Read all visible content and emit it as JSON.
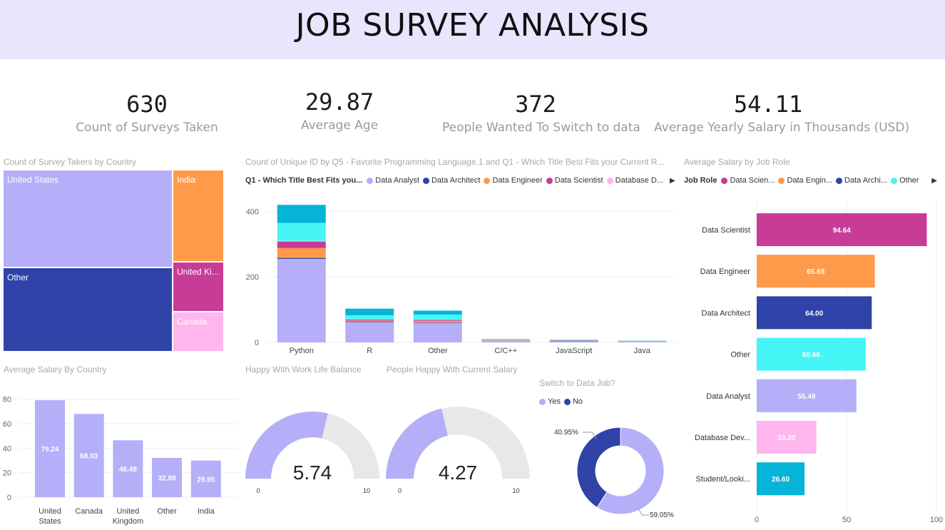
{
  "header": {
    "title": "JOB SURVEY ANALYSIS"
  },
  "kpis": [
    {
      "value": "630",
      "label": "Count of Surveys Taken"
    },
    {
      "value": "29.87",
      "label": "Average Age"
    },
    {
      "value": "372",
      "label": "People Wanted To Switch to data"
    },
    {
      "value": "54.11",
      "label": "Average Yearly Salary in Thousands (USD)"
    }
  ],
  "colors": {
    "Data Analyst": "#b4aff8",
    "Data Architect": "#2f43a8",
    "Data Engineer": "#ff9a4a",
    "Data Scientist": "#c83c98",
    "Database Developer": "#ffb6ee",
    "Other": "#46f5f5",
    "Student/Looking": "#05b4d6",
    "gauge_bg": "#e8e8e8"
  },
  "treemap": {
    "title": "Count of Survey Takers by Country",
    "cells": [
      {
        "label": "United States",
        "color": "#b4aff8"
      },
      {
        "label": "India",
        "color": "#ff9a4a"
      },
      {
        "label": "Other",
        "color": "#2f43a8"
      },
      {
        "label": "United Ki...",
        "color": "#c83c98"
      },
      {
        "label": "Canada",
        "color": "#ffb6ee"
      }
    ]
  },
  "lang_chart": {
    "title": "Count of Unique ID by Q5 - Favorite Programming Language.1 and Q1 - Which Title Best Fits your Current R...",
    "legend_title": "Q1 - Which Title Best Fits you...",
    "legend_items": [
      {
        "label": "Data Analyst",
        "color": "#b4aff8"
      },
      {
        "label": "Data Architect",
        "color": "#2f43a8"
      },
      {
        "label": "Data Engineer",
        "color": "#ff9a4a"
      },
      {
        "label": "Data Scientist",
        "color": "#c83c98"
      },
      {
        "label": "Database D...",
        "color": "#ffb6ee"
      }
    ],
    "legend_more": "▶"
  },
  "salary_country": {
    "title": "Average Salary By Country"
  },
  "gauge_wlb": {
    "title": "Happy With Work Life Balance",
    "value": "5.74",
    "min": "0",
    "max": "10"
  },
  "gauge_salary": {
    "title": "People Happy With Current Salary",
    "value": "4.27",
    "min": "0",
    "max": "10"
  },
  "donut": {
    "title": "Switch to Data Job?",
    "legend_items": [
      {
        "label": "Yes",
        "color": "#b4aff8"
      },
      {
        "label": "No",
        "color": "#2f43a8"
      }
    ],
    "no_label": "40.95%",
    "yes_label": "59.05%"
  },
  "salary_role": {
    "title": "Average Salary by Job Role",
    "legend_title": "Job Role",
    "legend_items": [
      {
        "label": "Data Scien...",
        "color": "#c83c98"
      },
      {
        "label": "Data Engin...",
        "color": "#ff9a4a"
      },
      {
        "label": "Data Archi...",
        "color": "#2f43a8"
      },
      {
        "label": "Other",
        "color": "#46f5f5"
      }
    ],
    "legend_more": "▶"
  },
  "chart_data": [
    {
      "type": "treemap",
      "title": "Count of Survey Takers by Country",
      "categories": [
        "United States",
        "Other",
        "India",
        "United Kingdom",
        "Canada"
      ],
      "values": [
        262,
        197,
        74,
        40,
        33
      ]
    },
    {
      "type": "bar",
      "stacked": true,
      "title": "Count of Unique ID by Q5 - Favorite Programming Language.1 and Q1 - Which Title Best Fits your Current R...",
      "categories": [
        "Python",
        "R",
        "Other",
        "C/C++",
        "JavaScript",
        "Java"
      ],
      "ylim": [
        0,
        440
      ],
      "yticks": [
        0,
        200,
        400
      ],
      "series": [
        {
          "name": "Data Analyst",
          "values": [
            255,
            62,
            60,
            5,
            3,
            2
          ]
        },
        {
          "name": "Data Architect",
          "values": [
            3,
            2,
            1,
            0,
            1,
            0
          ]
        },
        {
          "name": "Data Engineer",
          "values": [
            30,
            3,
            5,
            1,
            1,
            1
          ]
        },
        {
          "name": "Data Scientist",
          "values": [
            20,
            3,
            3,
            1,
            1,
            0
          ]
        },
        {
          "name": "Database D...",
          "values": [
            2,
            1,
            1,
            0,
            0,
            0
          ]
        },
        {
          "name": "Other",
          "values": [
            55,
            12,
            15,
            2,
            1,
            1
          ]
        },
        {
          "values": [
            55,
            20,
            12,
            1,
            1,
            1
          ]
        }
      ]
    },
    {
      "type": "bar",
      "title": "Average Salary By Country",
      "categories": [
        "United States",
        "Canada",
        "United Kingdom",
        "Other",
        "India"
      ],
      "category_lines": [
        [
          "United",
          "States"
        ],
        [
          "Canada"
        ],
        [
          "United",
          "Kingdom"
        ],
        [
          "Other"
        ],
        [
          "India"
        ]
      ],
      "values": [
        79.24,
        68.03,
        46.48,
        32.09,
        29.95
      ],
      "value_labels": [
        "79.24",
        "68.03",
        "46.48",
        "32.09",
        "29.95"
      ],
      "ylim": [
        0,
        88
      ],
      "yticks": [
        0,
        20,
        40,
        60,
        80
      ]
    },
    {
      "type": "gauge",
      "title": "Happy With Work Life Balance",
      "value": 5.74,
      "min": 0,
      "max": 10
    },
    {
      "type": "gauge",
      "title": "People Happy With Current Salary",
      "value": 4.27,
      "min": 0,
      "max": 10
    },
    {
      "type": "pie",
      "title": "Switch to Data Job?",
      "categories": [
        "Yes",
        "No"
      ],
      "values": [
        59.05,
        40.95
      ]
    },
    {
      "type": "bar",
      "orientation": "horizontal",
      "title": "Average Salary by Job Role",
      "categories": [
        "Data Scientist",
        "Data Engineer",
        "Data Architect",
        "Other",
        "Data Analyst",
        "Database Dev...",
        "Student/Looki..."
      ],
      "values": [
        94.64,
        65.68,
        64.0,
        60.66,
        55.48,
        33.2,
        26.6
      ],
      "value_labels": [
        "94.64",
        "65.68",
        "64.00",
        "60.66",
        "55.48",
        "33.20",
        "26.60"
      ],
      "xlim": [
        0,
        100
      ],
      "xticks": [
        0,
        50,
        100
      ]
    }
  ]
}
